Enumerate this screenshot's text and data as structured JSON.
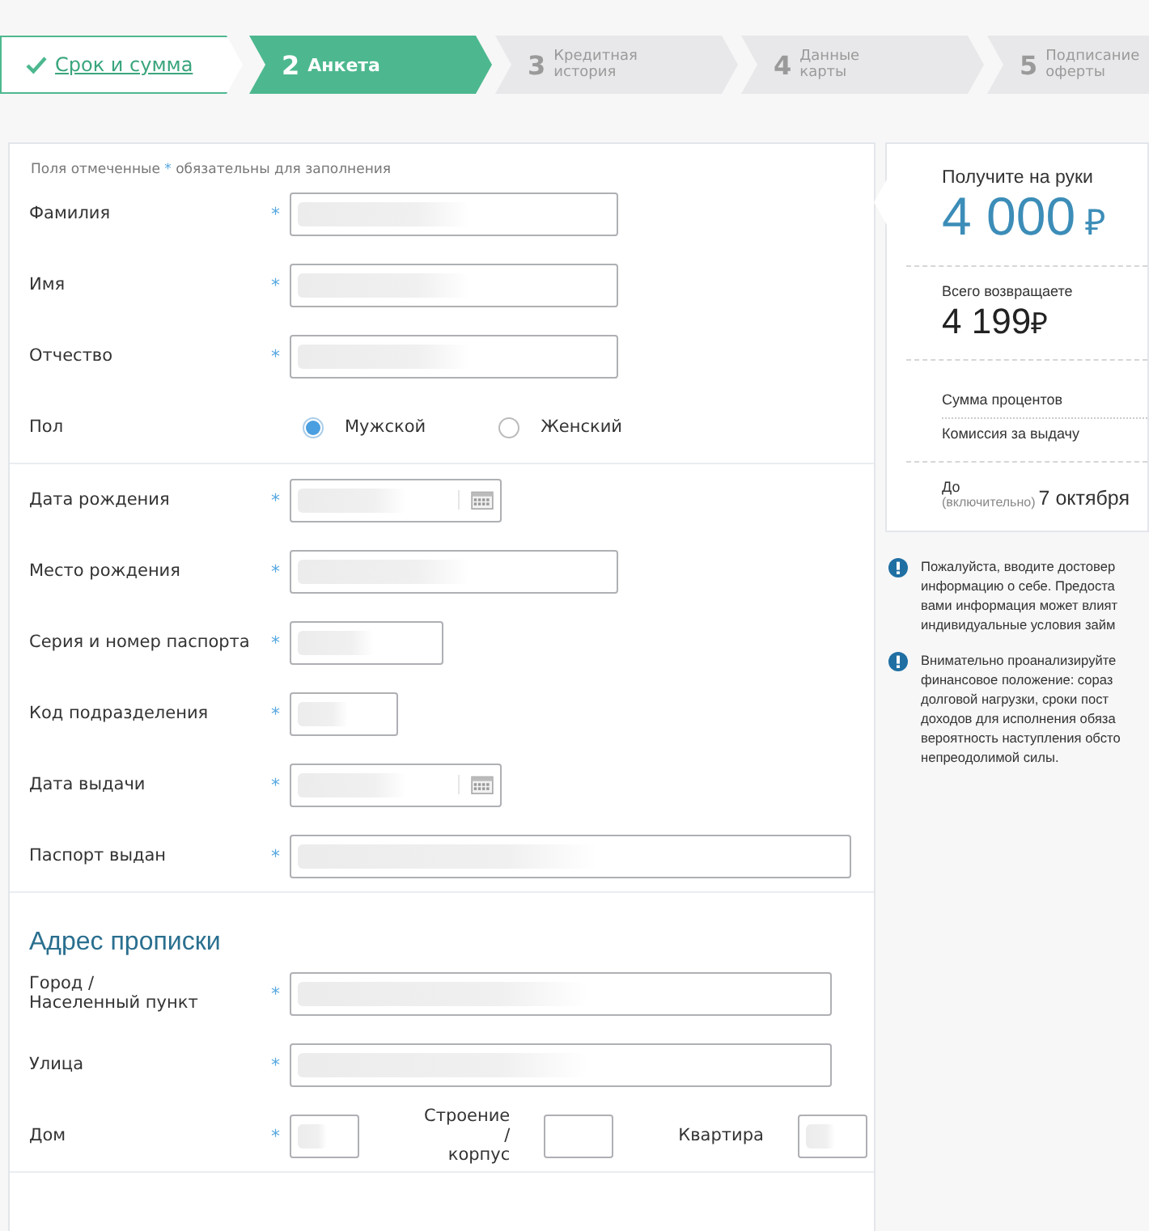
{
  "steps": [
    {
      "label": "Срок и сумма",
      "kind": "done"
    },
    {
      "number": "2",
      "label": "Анкета",
      "kind": "active"
    },
    {
      "number": "3",
      "label": "Кредитная история",
      "kind": "pending"
    },
    {
      "number": "4",
      "label": "Данные карты",
      "kind": "pending"
    },
    {
      "number": "5",
      "label": "Подписание оферты",
      "kind": "pending"
    }
  ],
  "form": {
    "required_note": {
      "before": "Поля отмеченные ",
      "mark": "*",
      "after": " обязательны для заполнения"
    },
    "sections": [
      {
        "fields": [
          {
            "kind": "wide",
            "label": "Фамилия",
            "required": true,
            "filled": true
          },
          {
            "kind": "wide",
            "label": "Имя",
            "required": true,
            "filled": true
          },
          {
            "kind": "wide",
            "label": "Отчество",
            "required": true,
            "filled": true
          },
          {
            "kind": "radio",
            "label": "Пол",
            "options": [
              {
                "label": "Мужской",
                "selected": true
              },
              {
                "label": "Женский",
                "selected": false
              }
            ]
          }
        ]
      },
      {
        "fields": [
          {
            "kind": "date",
            "label": "Дата рождения",
            "required": true,
            "filled": true
          },
          {
            "kind": "wide",
            "label": "Место рождения",
            "required": true,
            "filled": true
          },
          {
            "kind": "passport",
            "label": "Серия и номер паспорта",
            "required": true,
            "filled": true
          },
          {
            "kind": "code",
            "label": "Код подразделения",
            "required": true,
            "filled": true
          },
          {
            "kind": "date",
            "label": "Дата выдачи",
            "required": true,
            "filled": true
          },
          {
            "kind": "full",
            "label": "Паспорт выдан",
            "required": true,
            "filled": true
          }
        ]
      },
      {
        "title": "Адрес прописки",
        "fields": [
          {
            "kind": "address",
            "label": "Город /\nНаселенный пункт",
            "required": true,
            "filled": true
          },
          {
            "kind": "address",
            "label": "Улица",
            "required": true,
            "filled": true
          },
          {
            "kind": "triple",
            "parts": [
              {
                "label": "Дом",
                "required": true,
                "filled": true
              },
              {
                "label": "Строение /\nкорпус",
                "required": false,
                "filled": false
              },
              {
                "label": "Квартира",
                "required": false,
                "filled": true
              }
            ]
          }
        ]
      }
    ]
  },
  "summary": {
    "receive_label": "Получите на руки",
    "receive_amount": "4 000",
    "receive_currency": "₽",
    "return_label": "Всего возвращаете",
    "return_amount": "4 199",
    "return_currency": "₽",
    "details": [
      "Сумма процентов",
      "Комиссия за выдачу"
    ],
    "due_label": "До",
    "due_note": "(включительно)",
    "due_date": "7 октября"
  },
  "notes": [
    "Пожалуйста, вводите достовер\nинформацию о себе. Предоста\nвами информация может влият\nиндивидуальные условия займ",
    "Внимательно проанализируйте\nфинансовое положение: сораз\nдолговой нагрузки, сроки пост\nдоходов для исполнения обяза\nвероятность наступления обсто\nнепреодолимой силы."
  ]
}
